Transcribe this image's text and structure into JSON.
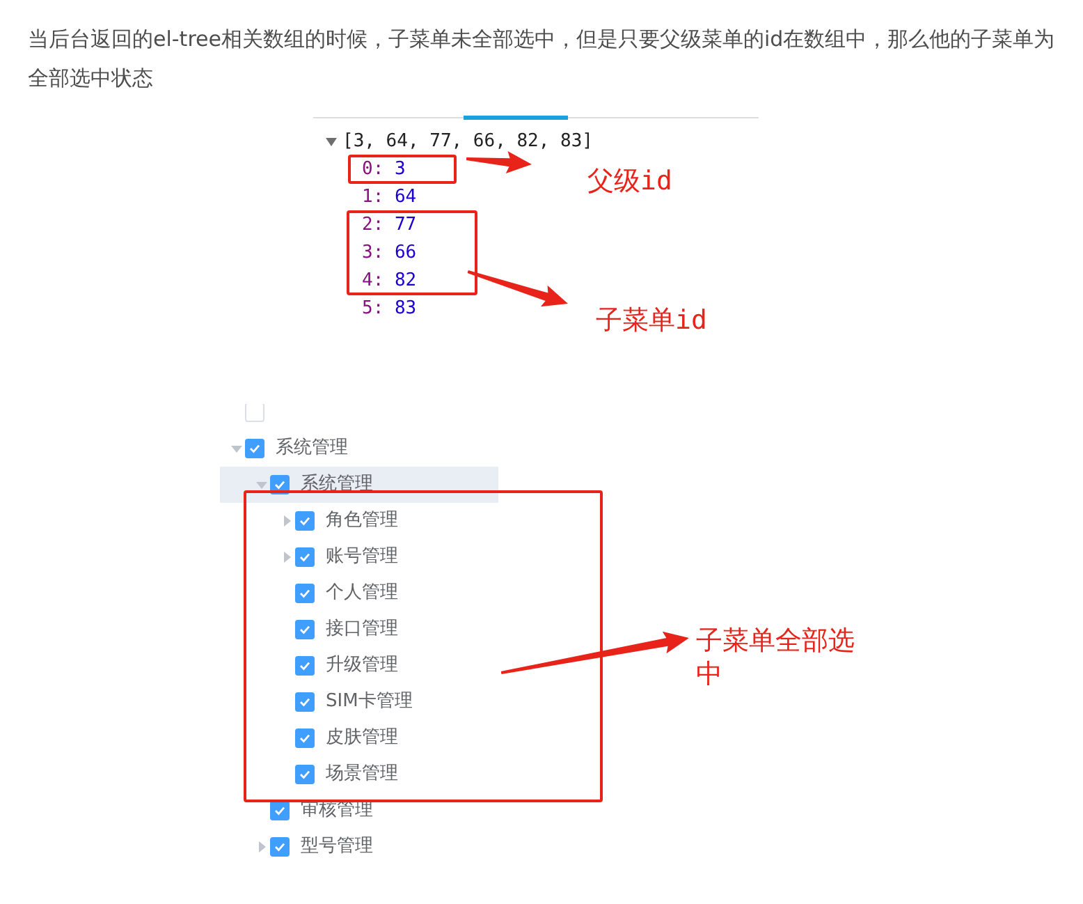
{
  "paragraph": "当后台返回的el-tree相关数组的时候，子菜单未全部选中，但是只要父级菜单的id在数组中，那么他的子菜单为全部选中状态",
  "console": {
    "summary": "[3, 64, 77, 66, 82, 83]",
    "expanded": true,
    "entries": [
      {
        "index": "0:",
        "value": "3"
      },
      {
        "index": "1:",
        "value": "64"
      },
      {
        "index": "2:",
        "value": "77"
      },
      {
        "index": "3:",
        "value": "66"
      },
      {
        "index": "4:",
        "value": "82"
      },
      {
        "index": "5:",
        "value": "83"
      }
    ],
    "annotations": [
      "父级id",
      "子菜单id"
    ]
  },
  "tree": {
    "nodes": [
      {
        "checked": false,
        "selected": false
      },
      {
        "label": "系统管理",
        "checked": true,
        "selected": false,
        "expanded": true,
        "children": [
          {
            "label": "系统管理",
            "checked": true,
            "selected": true,
            "expanded": true,
            "children": [
              {
                "label": "角色管理",
                "checked": true,
                "selected": false,
                "expanded": false
              },
              {
                "label": "账号管理",
                "checked": true,
                "selected": false,
                "expanded": false
              },
              {
                "label": "个人管理",
                "checked": true,
                "selected": false
              },
              {
                "label": "接口管理",
                "checked": true,
                "selected": false
              },
              {
                "label": "升级管理",
                "checked": true,
                "selected": false
              },
              {
                "label": "SIM卡管理",
                "checked": true,
                "selected": false
              },
              {
                "label": "皮肤管理",
                "checked": true,
                "selected": false
              },
              {
                "label": "场景管理",
                "checked": true,
                "selected": false
              }
            ]
          },
          {
            "label": "审核管理",
            "checked": true,
            "selected": false
          },
          {
            "label": "型号管理",
            "checked": true,
            "selected": false,
            "expanded": false
          }
        ]
      }
    ],
    "annotation": "子菜单全部选中"
  }
}
